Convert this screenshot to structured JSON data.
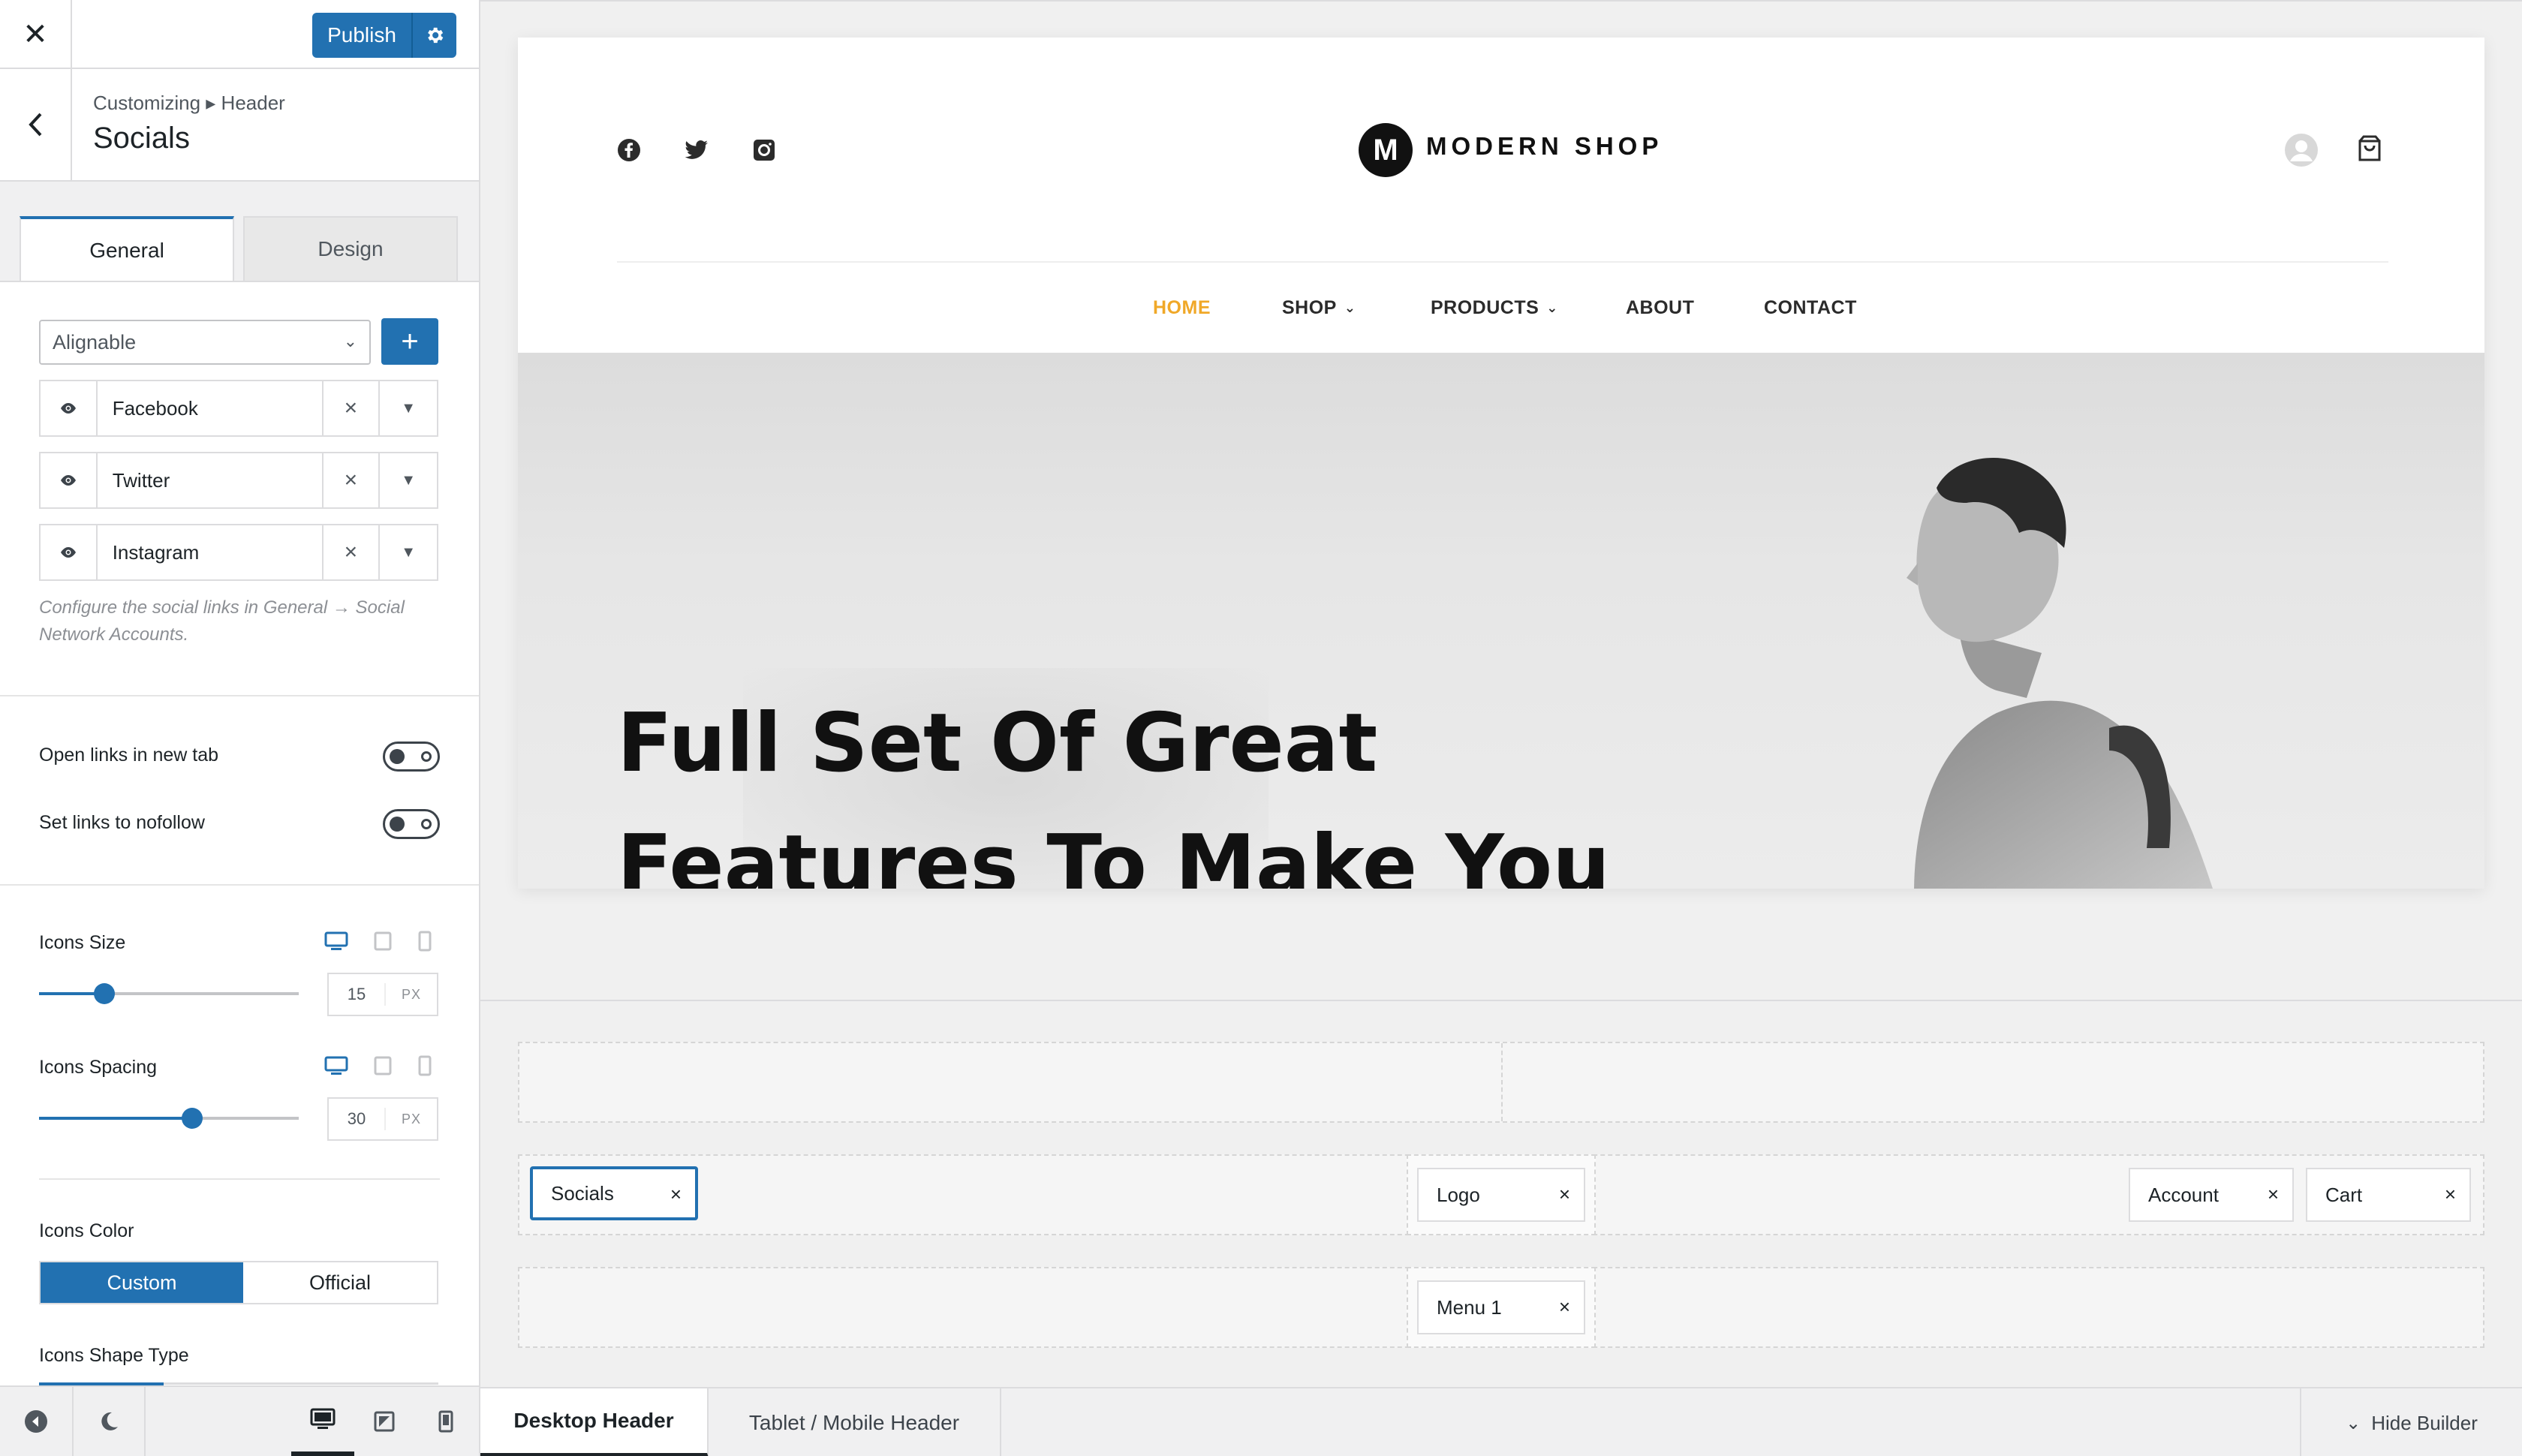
{
  "topbar": {
    "publish_label": "Publish"
  },
  "header": {
    "breadcrumb": "Customizing ▸ Header",
    "title": "Socials"
  },
  "tabs": [
    {
      "label": "General",
      "active": true
    },
    {
      "label": "Design",
      "active": false
    }
  ],
  "select": {
    "value": "Alignable"
  },
  "socials": [
    {
      "label": "Facebook"
    },
    {
      "label": "Twitter"
    },
    {
      "label": "Instagram"
    }
  ],
  "help_text": "Configure the social links in General → Social Network Accounts.",
  "toggles": {
    "new_tab": {
      "label": "Open links in new tab",
      "on": false
    },
    "nofollow": {
      "label": "Set links to nofollow",
      "on": false
    }
  },
  "icons_size": {
    "label": "Icons Size",
    "value": "15",
    "unit": "PX",
    "fraction": 0.25
  },
  "icons_spacing": {
    "label": "Icons Spacing",
    "value": "30",
    "unit": "PX",
    "fraction": 0.59
  },
  "icons_color": {
    "label": "Icons Color",
    "options": [
      "Custom",
      "Official"
    ],
    "selected": "Custom"
  },
  "icons_shape": {
    "label": "Icons Shape Type"
  },
  "site": {
    "logo_letter": "M",
    "logo_text": "MODERN SHOP",
    "nav": [
      "HOME",
      "SHOP",
      "PRODUCTS",
      "ABOUT",
      "CONTACT"
    ],
    "hero_line1": "Full Set Of Great",
    "hero_line2": "Features To Make You",
    "accent": "#f0a828"
  },
  "builder": {
    "socials": "Socials",
    "logo": "Logo",
    "account": "Account",
    "cart": "Cart",
    "menu": "Menu 1"
  },
  "bottom": {
    "desktop_tab": "Desktop Header",
    "mobile_tab": "Tablet / Mobile Header",
    "hide_builder": "Hide Builder"
  },
  "colors": {
    "primary": "#2271b1",
    "border": "#dcdcde"
  }
}
